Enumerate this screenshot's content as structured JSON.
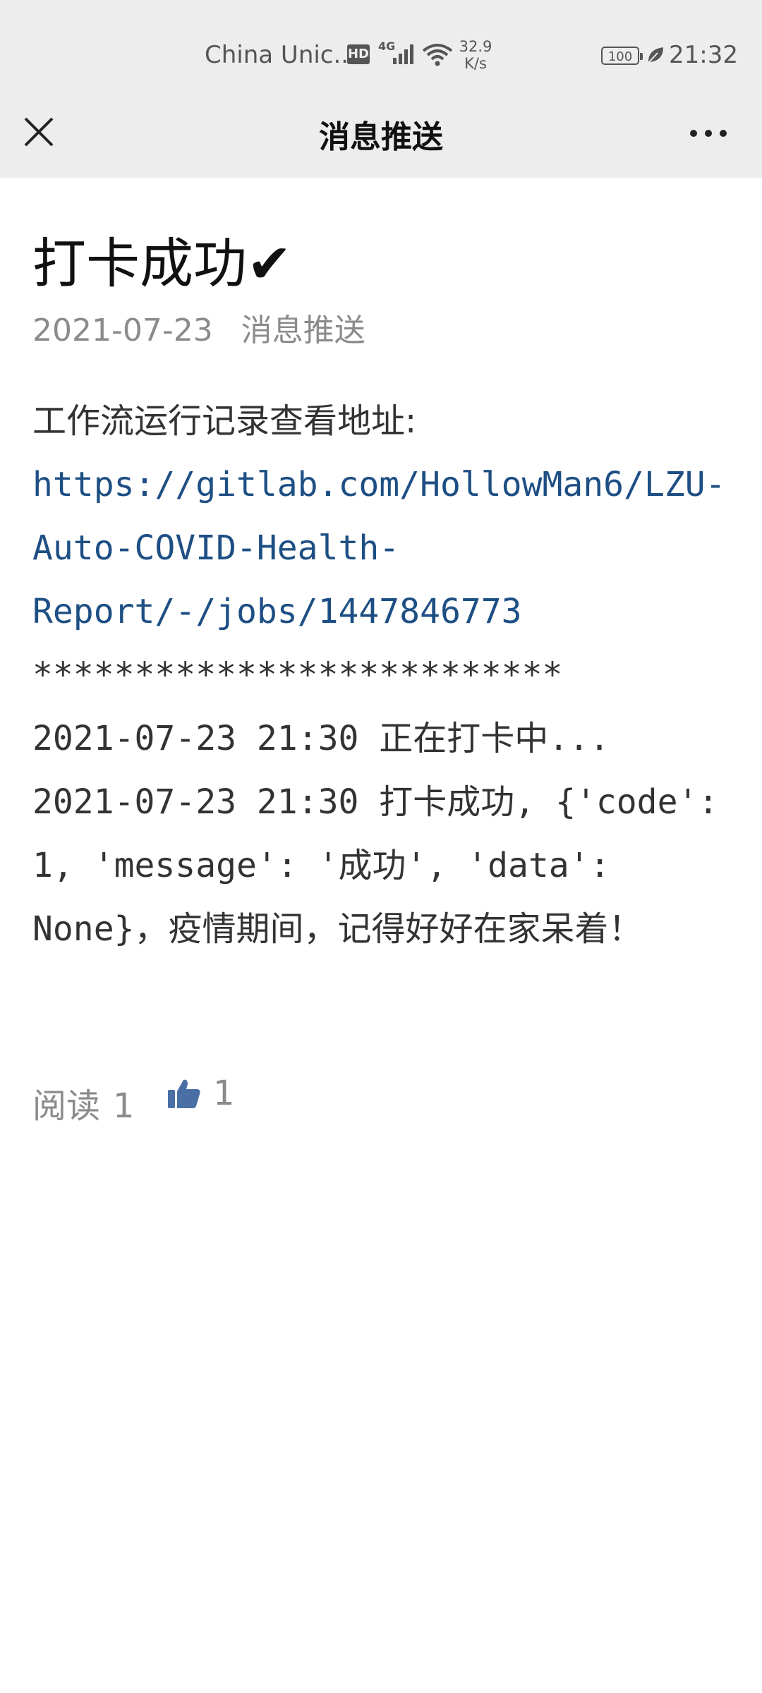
{
  "status_bar": {
    "carrier": "China Unic...",
    "hd": "HD",
    "network": "4G",
    "speed_value": "32.9",
    "speed_unit": "K/s",
    "battery": "100",
    "time": "21:32"
  },
  "nav": {
    "title": "消息推送",
    "close_icon": "close-icon",
    "more_icon": "more-icon"
  },
  "article": {
    "title": "打卡成功✔",
    "date": "2021-07-23",
    "author": "消息推送",
    "body_label": "工作流运行记录查看地址:",
    "link": "https://gitlab.com/HollowMan6/LZU-Auto-COVID-Health-Report/-/jobs/1447846773",
    "separator": "**************************",
    "log_line_1": "2021-07-23 21:30 正在打卡中...",
    "log_line_2": "2021-07-23 21:30 打卡成功, {'code': 1, 'message': '成功', 'data': None}，疫情期间，记得好好在家呆着！"
  },
  "stats": {
    "read_label": "阅读",
    "read_count": "1",
    "like_count": "1"
  },
  "colors": {
    "bar_bg": "#ededed",
    "link": "#1e4f84",
    "like": "#4a6fa5",
    "meta": "#8b8b8b"
  }
}
